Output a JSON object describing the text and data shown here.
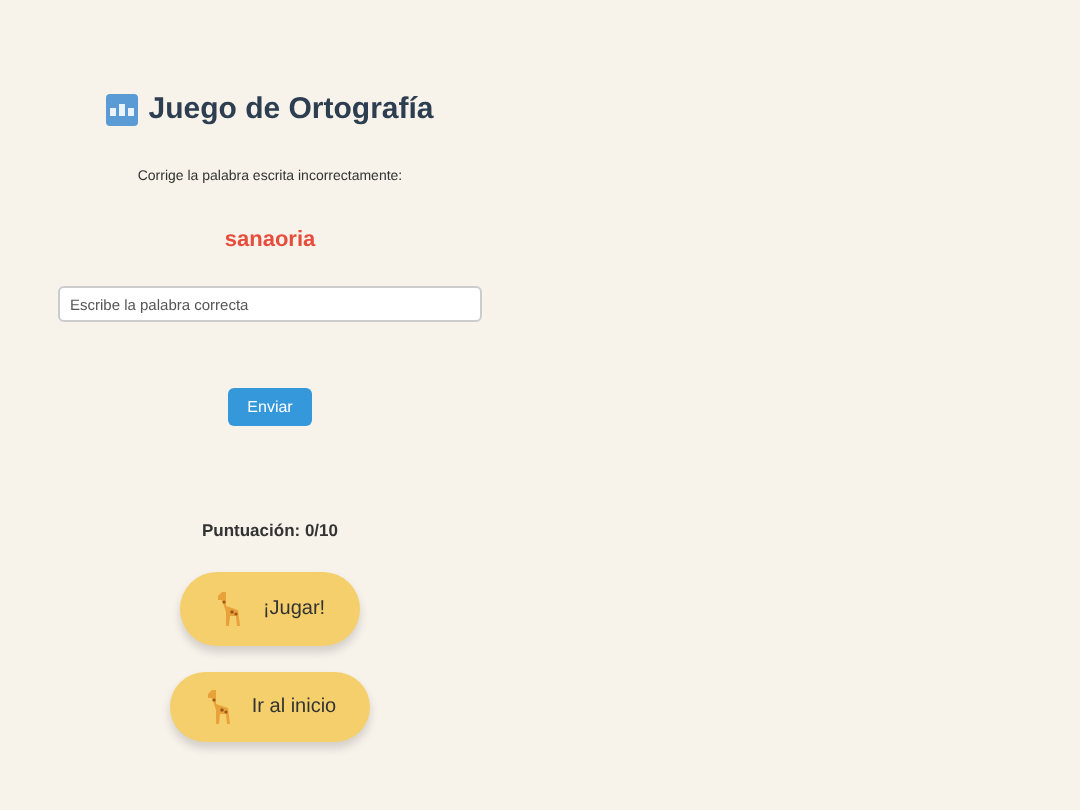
{
  "title": "Juego de Ortografía",
  "instruction": "Corrige la palabra escrita incorrectamente:",
  "word": "sanaoria",
  "answer": {
    "placeholder": "Escribe la palabra correcta"
  },
  "submit": "Enviar",
  "score": "Puntuación: 0/10",
  "buttons": [
    {
      "label": "¡Jugar!"
    },
    {
      "label": "Ir al inicio"
    }
  ]
}
